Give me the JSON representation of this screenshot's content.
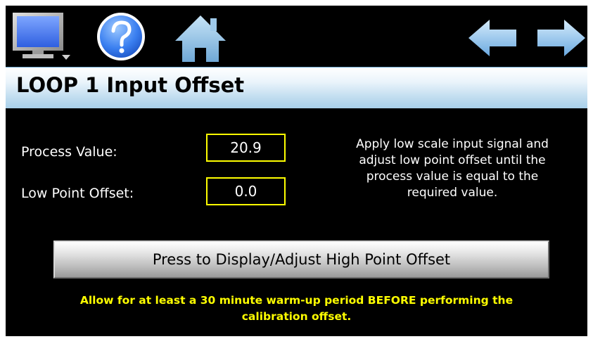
{
  "toolbar": {
    "icons": [
      "monitor-icon",
      "help-icon",
      "home-icon",
      "back-arrow-icon",
      "forward-arrow-icon"
    ]
  },
  "page": {
    "title": "LOOP 1 Input Offset"
  },
  "fields": {
    "process_value": {
      "label": "Process Value:",
      "value": "20.9"
    },
    "low_point_offset": {
      "label": "Low Point Offset:",
      "value": "0.0"
    }
  },
  "instructions": {
    "lines": [
      "Apply low scale input signal and",
      "adjust low point offset until the",
      "process value is equal to the",
      "required value."
    ]
  },
  "action_button": {
    "label": "Press to Display/Adjust High Point Offset"
  },
  "warning": {
    "lines": [
      "Allow for at least a 30 minute warm-up period BEFORE performing the",
      "calibration offset."
    ]
  },
  "colors": {
    "background": "#000000",
    "title_gradient_bottom": "#a9d0ea",
    "value_box_border": "#ffff00",
    "warning_text": "#ffff00",
    "arrow": "#7ab8e8"
  }
}
